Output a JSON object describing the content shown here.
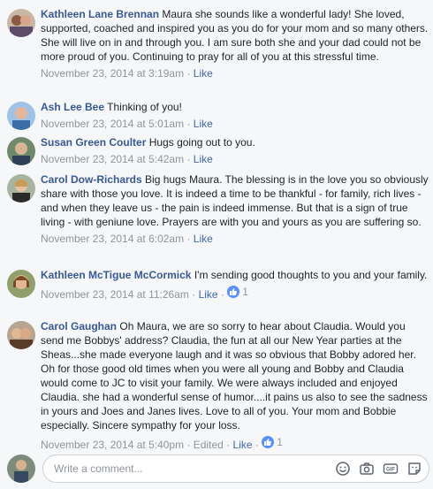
{
  "comments": [
    {
      "author": "Kathleen Lane Brennan",
      "text": "Maura she sounds like a wonderful lady! She loved, supported, coached and inspired you as you do for your mom and so many others. She will live on in and through you. I am sure both she and your dad could not be more proud of you. Continuing to pray for all of you at this stressful time.",
      "time": "November 23, 2014 at 3:19am",
      "like_label": "Like"
    },
    {
      "author": "Ash Lee Bee",
      "text": "Thinking of you!",
      "time": "November 23, 2014 at 5:01am",
      "like_label": "Like"
    },
    {
      "author": "Susan Green Coulter",
      "text": "Hugs going out to you.",
      "time": "November 23, 2014 at 5:42am",
      "like_label": "Like"
    },
    {
      "author": "Carol Dow-Richards",
      "text": "Big hugs Maura. The blessing is in the love you so obviously share with those you love. It is indeed a time to be thankful - for family, rich lives - and when they leave us - the pain is indeed immense. But that is a sign of true living - with geniune love. Prayers are with you and yours as you are suffering so.",
      "time": "November 23, 2014 at 6:02am",
      "like_label": "Like"
    },
    {
      "author": "Kathleen McTigue McCormick",
      "text": "I'm sending good thoughts to you and your family.",
      "time": "November 23, 2014 at 11:26am",
      "like_label": "Like",
      "like_count": "1"
    },
    {
      "author": "Carol Gaughan",
      "text": "Oh Maura, we are so sorry to hear about Claudia. Would you send me Bobbys' address? Claudia, the fun at all our New Year parties at the Sheas...she made everyone laugh and it was so obvious that Bobby adored her. Oh for those good old times when you were all young and Bobby and Claudia would come to JC to visit your family. We were always included and enjoyed Claudia. she had a wonderful sense of humor....it pains us also to see the sadness in yours and Joes and Janes lives. Love to all of you. Your mom and Bobbie especially. Sincere sympathy for your loss.",
      "time": "November 23, 2014 at 5:40pm",
      "edited_label": "Edited",
      "like_label": "Like",
      "like_count": "1"
    }
  ],
  "composer": {
    "placeholder": "Write a comment...",
    "icons": [
      "emoji-icon",
      "camera-icon",
      "gif-icon",
      "sticker-icon"
    ]
  },
  "colors": {
    "link": "#385898",
    "meta": "#90949c",
    "like_blue": "#5890ff",
    "background": "#f6f7f9"
  }
}
